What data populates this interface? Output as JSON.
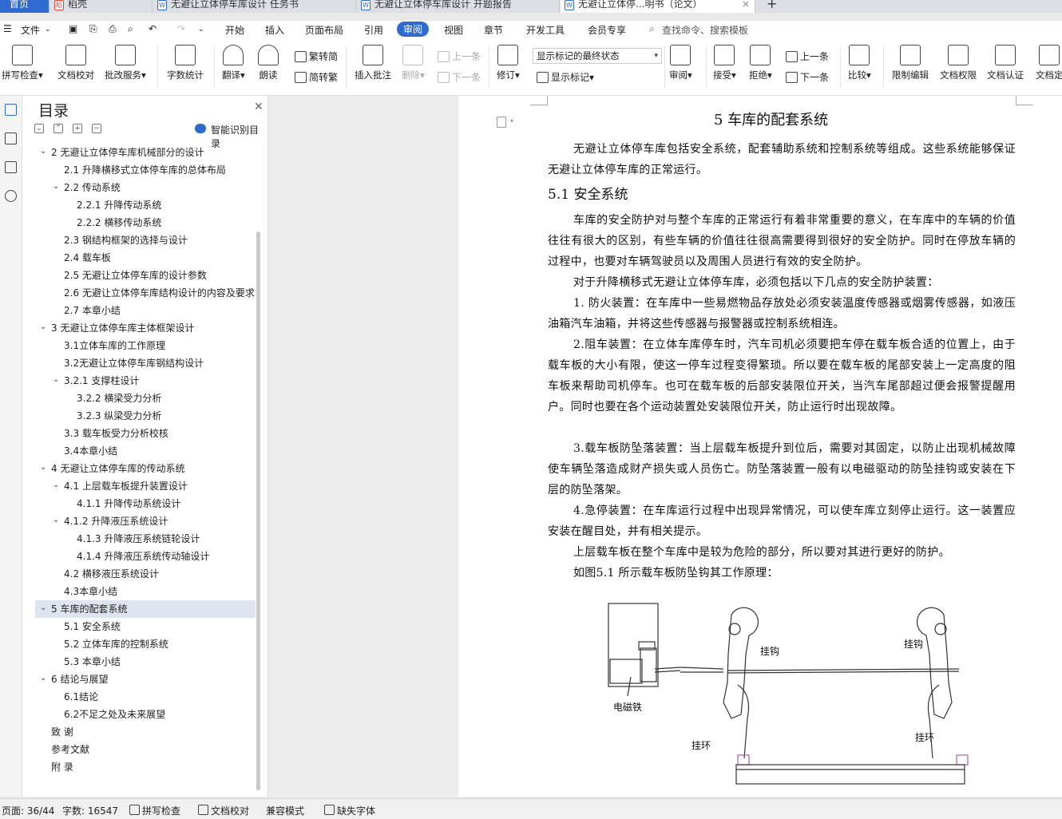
{
  "tabs": [
    {
      "label": "首页"
    },
    {
      "label": "稻壳"
    },
    {
      "label": "无避让立体停车库设计 任务书"
    },
    {
      "label": "无避让立体停车库设计 开题报告"
    },
    {
      "label": "无避让立体停...明书（论文）"
    }
  ],
  "tab_new": "+",
  "tab_close": "×",
  "menu": {
    "file": "文件",
    "items": [
      "开始",
      "插入",
      "页面布局",
      "引用",
      "审阅",
      "视图",
      "章节",
      "开发工具",
      "会员专享"
    ],
    "active": "审阅",
    "search": "查找命令、搜索模板"
  },
  "toolbar": {
    "spell_check": "拼写检查",
    "doc_proof": "文档校对",
    "batch_service": "批改服务",
    "word_count": "字数统计",
    "translate": "翻译",
    "read_aloud": "朗读",
    "to_simplified": "繁转简",
    "to_traditional": "简转繁",
    "insert_comment": "插入批注",
    "delete": "删除",
    "prev_comment": "上一条",
    "next_comment": "下一条",
    "revise": "修订",
    "markup_mode": "显示标记的最终状态",
    "show_markup": "显示标记",
    "review": "审阅",
    "accept": "接受",
    "reject": "拒绝",
    "prev_change": "上一条",
    "next_change": "下一条",
    "compare": "比较",
    "restrict_edit": "限制编辑",
    "doc_permission": "文档权限",
    "doc_certify": "文档认证",
    "doc_more": "文档定"
  },
  "nav": {
    "title": "目录",
    "smart_toc": "智能识别目录",
    "items": [
      {
        "text": "2  无避让立体停车库机械部分的设计",
        "level": 1,
        "chev": "v"
      },
      {
        "text": "2.1  升降横移式立体停车库的总体布局",
        "level": 2,
        "chev": ""
      },
      {
        "text": "2.2  传动系统",
        "level": 2,
        "chev": "v"
      },
      {
        "text": "2.2.1 升降传动系统",
        "level": 3,
        "chev": ""
      },
      {
        "text": "2.2.2 横移传动系统",
        "level": 3,
        "chev": ""
      },
      {
        "text": "2.3  钢结构框架的选择与设计",
        "level": 2,
        "chev": ""
      },
      {
        "text": "2.4  载车板",
        "level": 2,
        "chev": ""
      },
      {
        "text": "2.5  无避让立体停车库的设计参数",
        "level": 2,
        "chev": ""
      },
      {
        "text": "2.6  无避让立体停车库结构设计的内容及要求",
        "level": 2,
        "chev": ""
      },
      {
        "text": "2.7  本章小结",
        "level": 2,
        "chev": ""
      },
      {
        "text": "3  无避让立体停车库主体框架设计",
        "level": 1,
        "chev": "v"
      },
      {
        "text": "3.1立体车库的工作原理",
        "level": 2,
        "chev": ""
      },
      {
        "text": "3.2无避让立体停车库钢结构设计",
        "level": 2,
        "chev": ""
      },
      {
        "text": "3.2.1  支撑柱设计",
        "level": 2,
        "chev": "v"
      },
      {
        "text": "3.2.2  横梁受力分析",
        "level": 3,
        "chev": ""
      },
      {
        "text": "3.2.3  纵梁受力分析",
        "level": 3,
        "chev": ""
      },
      {
        "text": "3.3  载车板受力分析校核",
        "level": 2,
        "chev": ""
      },
      {
        "text": "3.4本章小结",
        "level": 2,
        "chev": ""
      },
      {
        "text": "4  无避让立体停车库的传动系统",
        "level": 1,
        "chev": "v"
      },
      {
        "text": "4.1  上层载车板提升装置设计",
        "level": 2,
        "chev": "v"
      },
      {
        "text": "4.1.1  升降传动系统设计",
        "level": 3,
        "chev": ""
      },
      {
        "text": "4.1.2  升降液压系统设计",
        "level": 2,
        "chev": "v"
      },
      {
        "text": "4.1.3  升降液压系统链轮设计",
        "level": 3,
        "chev": ""
      },
      {
        "text": "4.1.4  升降液压系统传动轴设计",
        "level": 3,
        "chev": ""
      },
      {
        "text": "4.2  横移液压系统设计",
        "level": 2,
        "chev": ""
      },
      {
        "text": "4.3本章小结",
        "level": 2,
        "chev": ""
      },
      {
        "text": "5  车库的配套系统",
        "level": 1,
        "chev": "v",
        "active": true
      },
      {
        "text": "5.1  安全系统",
        "level": 2,
        "chev": ""
      },
      {
        "text": "5.2  立体车库的控制系统",
        "level": 2,
        "chev": ""
      },
      {
        "text": "5.3  本章小结",
        "level": 2,
        "chev": ""
      },
      {
        "text": "6  结论与展望",
        "level": 1,
        "chev": "v"
      },
      {
        "text": "6.1结论",
        "level": 2,
        "chev": ""
      },
      {
        "text": "6.2不足之处及未来展望",
        "level": 2,
        "chev": ""
      },
      {
        "text": "致  谢",
        "level": 1,
        "chev": ""
      },
      {
        "text": "参考文献",
        "level": 1,
        "chev": ""
      },
      {
        "text": "附  录",
        "level": 1,
        "chev": ""
      }
    ]
  },
  "doc": {
    "heading": "5  车库的配套系统",
    "subheading": "5.1  安全系统",
    "paragraphs": [
      "无避让立体停车库包括安全系统，配套辅助系统和控制系统等组成。这些系统能够保证无避让立体停车库的正常运行。",
      "车库的安全防护对与整个车库的正常运行有着非常重要的意义，在车库中的车辆的价值往往有很大的区别，有些车辆的价值往往很高需要得到很好的安全防护。同时在停放车辆的过程中，也要对车辆驾驶员以及周围人员进行有效的安全防护。",
      "对于升降横移式无避让立体停车库，必须包括以下几点的安全防护装置：",
      "1. 防火装置：在车库中一些易燃物品存放处必须安装温度传感器或烟雾传感器，如液压油箱汽车油箱，并将这些传感器与报警器或控制系统相连。",
      "2.阻车装置：在立体车库停车时，汽车司机必须要把车停在载车板合适的位置上，由于载车板的大小有限，使这一停车过程变得繁琐。所以要在载车板的尾部安装上一定高度的阻车板来帮助司机停车。也可在载车板的后部安装限位开关，当汽车尾部超过便会报警提醒用户。同时也要在各个运动装置处安装限位开关，防止运行时出现故障。",
      "3.载车板防坠落装置：当上层载车板提升到位后，需要对其固定，以防止出现机械故障使车辆坠落造成财产损失或人员伤亡。防坠落装置一般有以电磁驱动的防坠挂钩或安装在下层的防坠落架。",
      "4.急停装置：在车库运行过程中出现异常情况，可以使车库立刻停止运行。这一装置应安装在醒目处，并有相关提示。",
      "上层载车板在整个车库中是较为危险的部分，所以要对其进行更好的防护。",
      "如图5.1  所示载车板防坠钩其工作原理："
    ],
    "figure_labels": {
      "hook_left": "挂钩",
      "hook_right": "挂钩",
      "magnet": "电磁铁",
      "ring_left": "挂环",
      "ring_right": "挂环"
    }
  },
  "status": {
    "page": "页面: 36/44",
    "words": "字数: 16547",
    "spell": "拼写检查",
    "proof": "文档校对",
    "compat": "兼容模式",
    "missing_font": "缺失字体"
  }
}
